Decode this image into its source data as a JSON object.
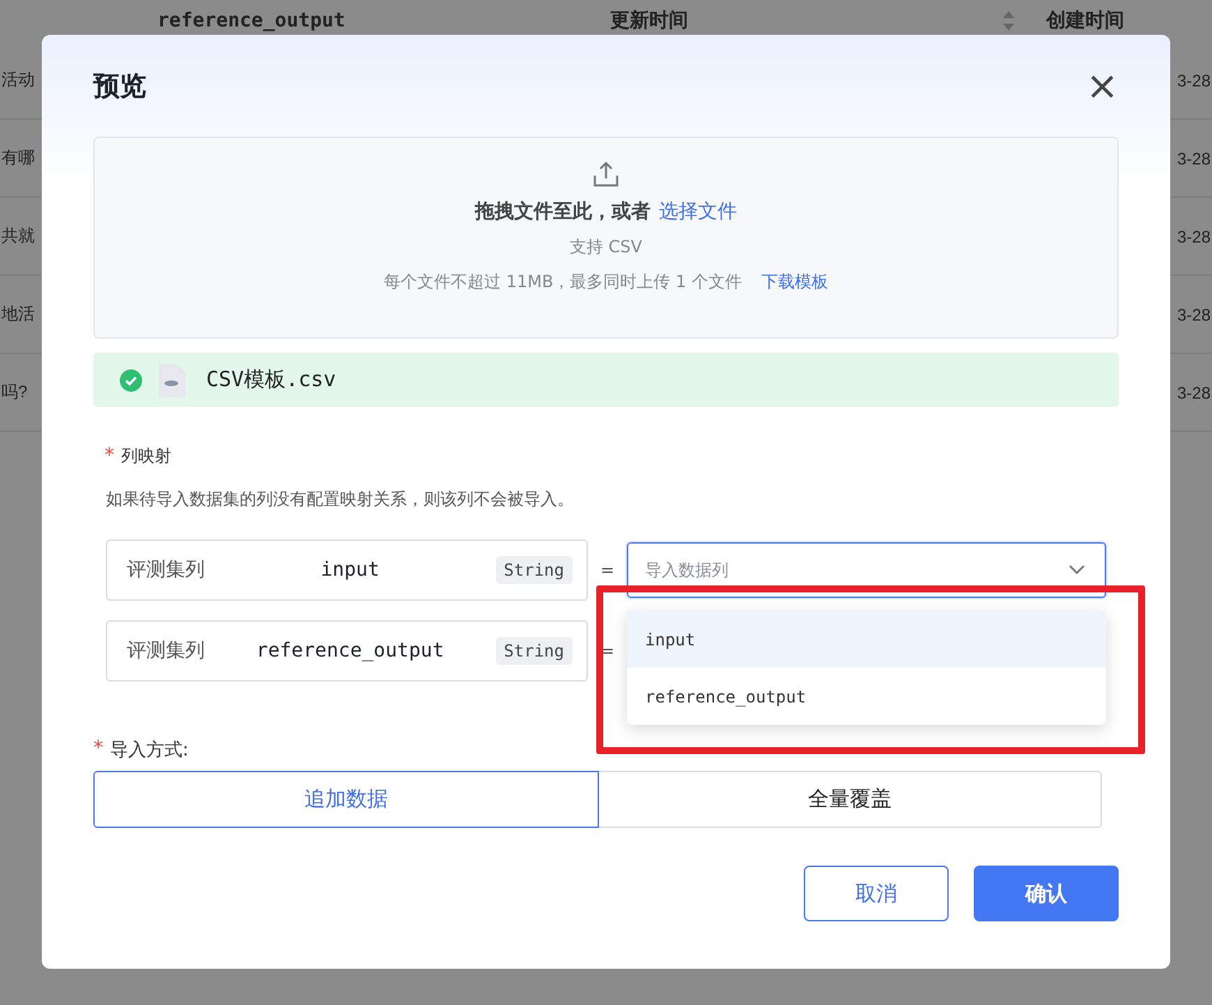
{
  "background_table": {
    "columns": [
      "reference_output",
      "更新时间",
      "创建时间"
    ],
    "rows": [
      {
        "left": "活动",
        "right": "3-28"
      },
      {
        "left": "有哪",
        "right": "3-28"
      },
      {
        "left": "共就",
        "right": "3-28"
      },
      {
        "left": "地活",
        "right": "3-28"
      },
      {
        "left": "吗?",
        "right": "3-28"
      }
    ]
  },
  "dialog": {
    "title": "预览",
    "close": "×",
    "upload": {
      "prompt": "拖拽文件至此，或者",
      "link": "选择文件",
      "support": "支持 CSV",
      "limit": "每个文件不超过 11MB，最多同时上传 1 个文件",
      "template_link": "下载模板"
    },
    "file": {
      "name": "CSV模板.csv",
      "uploaded": true
    },
    "mapping": {
      "label": "列映射",
      "required_mark": "*",
      "hint": "如果待导入数据集的列没有配置映射关系，则该列不会被导入。",
      "rows": [
        {
          "prefix": "评测集列",
          "column": "input",
          "type": "String",
          "equals": "=",
          "select": {
            "placeholder": "导入数据列",
            "focused": true
          }
        },
        {
          "prefix": "评测集列",
          "column": "reference_output",
          "type": "String",
          "equals": "="
        }
      ],
      "dropdown": {
        "open": true,
        "options": [
          {
            "label": "input",
            "selected": true
          },
          {
            "label": "reference_output",
            "selected": false
          }
        ]
      }
    },
    "import_mode": {
      "label": "导入方式:",
      "required_mark": "*",
      "options": [
        {
          "label": "追加数据",
          "selected": true
        },
        {
          "label": "全量覆盖",
          "selected": false
        }
      ]
    },
    "buttons": [
      {
        "label": "取消",
        "kind": "secondary"
      },
      {
        "label": "确认",
        "kind": "primary"
      }
    ]
  },
  "highlight_box": true
}
